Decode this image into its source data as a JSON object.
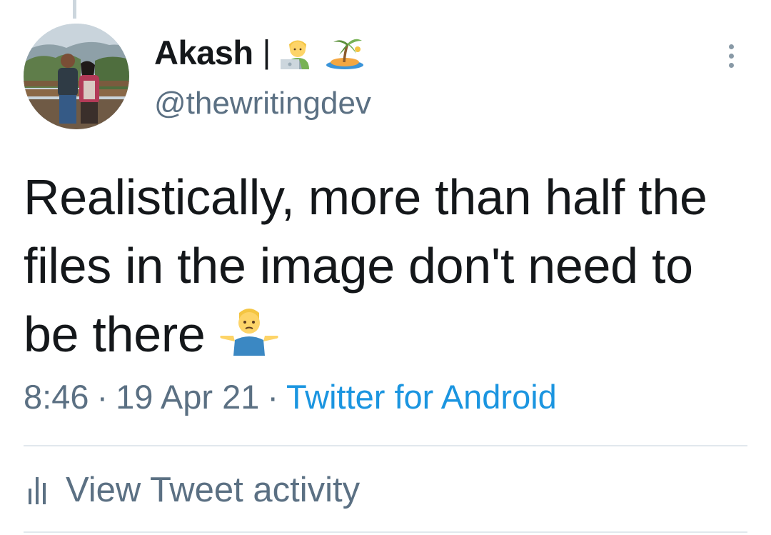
{
  "tweet": {
    "author": {
      "display_name": "Akash",
      "separator": "|",
      "name_emojis": [
        "technologist-icon",
        "desert-island-icon"
      ],
      "handle": "@thewritingdev",
      "avatar": "profile-photo"
    },
    "text": "Realistically, more than half the files in the image don't need to be there",
    "text_emoji": "person-shrugging-icon",
    "time": "8:46",
    "date": "19 Apr 21",
    "meta_separator": "·",
    "source": "Twitter for Android",
    "activity_label": "View Tweet activity"
  },
  "colors": {
    "text_primary": "#14171a",
    "text_secondary": "#5b7083",
    "link": "#1b95e0",
    "divider": "#e1e8ed"
  }
}
